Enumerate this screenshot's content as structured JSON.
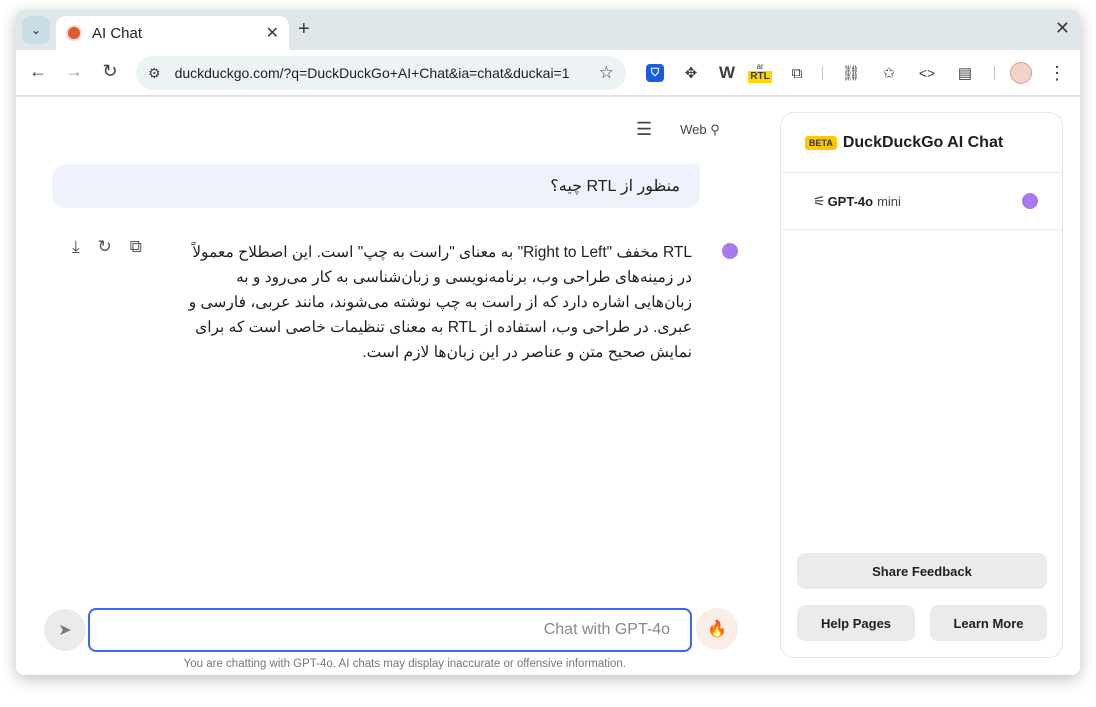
{
  "browser": {
    "tab_title": "AI Chat",
    "tab_close": "✕",
    "new_tab": "+",
    "window_close": "✕",
    "url": "duckduckgo.com/?q=DuckDuckGo+AI+Chat&ia=chat&duckai=1",
    "ext_rtl_small": "ar",
    "ext_rtl_badge": "RTL"
  },
  "chat": {
    "web_label": "Web",
    "user_message": "منظور از RTL چیه؟",
    "ai_message": "RTL مخفف \"Right to Left\" به معنای \"راست به چپ\" است. این اصطلاح معمولاً در زمینه‌های طراحی وب، برنامه‌نویسی و زبان‌شناسی به کار می‌رود و به زبان‌هایی اشاره دارد که از راست به چپ نوشته می‌شوند، مانند عربی، فارسی و عبری. در طراحی وب، استفاده از RTL به معنای تنظیمات خاصی است که برای نمایش صحیح متن و عناصر در این زبان‌ها لازم است.",
    "input_placeholder": "Chat with GPT-4o",
    "disclaimer": "You are chatting with GPT-4o. AI chats may display inaccurate or offensive information."
  },
  "panel": {
    "beta": "BETA",
    "title": "DuckDuckGo AI Chat",
    "model_name": "GPT-4o",
    "model_variant": "mini",
    "share_feedback": "Share Feedback",
    "help_pages": "Help Pages",
    "learn_more": "Learn More"
  },
  "colors": {
    "accent": "#3969ef",
    "ai_dot": "#a77af0",
    "beta": "#ffc700"
  }
}
